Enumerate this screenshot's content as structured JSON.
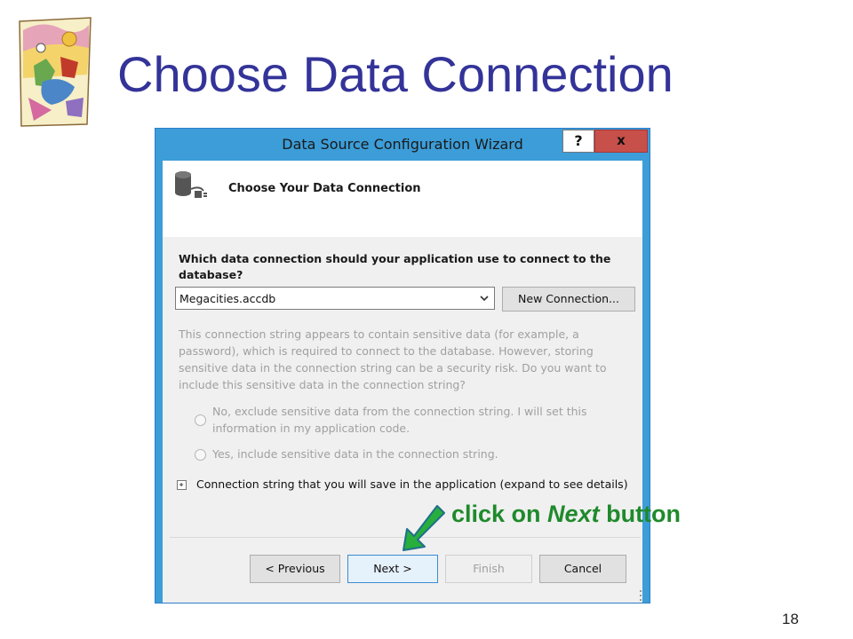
{
  "slide": {
    "title": "Choose Data Connection",
    "number": "18"
  },
  "dialog": {
    "title": "Data Source Configuration Wizard",
    "help_label": "?",
    "close_label": "x",
    "header_title": "Choose Your Data Connection",
    "question": "Which data connection should your application use to connect to the database?",
    "connection_select": {
      "value": "Megacities.accdb"
    },
    "new_connection_label": "New Connection...",
    "info_text": "This connection string appears to contain sensitive data (for example, a password), which is required to connect to the database. However, storing sensitive data in the connection string can be a security risk. Do you want to include this sensitive data in the connection string?",
    "options": [
      {
        "label": "No, exclude sensitive data from the connection string. I will set this information in my application code."
      },
      {
        "label": "Yes, include sensitive data in the connection string."
      }
    ],
    "expander_label": "Connection string that you will save in the application (expand to see details)",
    "buttons": {
      "previous": "< Previous",
      "next": "Next >",
      "finish": "Finish",
      "cancel": "Cancel"
    }
  },
  "annotation": {
    "before": "click on ",
    "emphasis": "Next",
    "after": " button",
    "color": "#1f8a2b"
  },
  "colors": {
    "title": "#333399",
    "titlebar": "#3c9dd8",
    "close": "#c7504a"
  },
  "icons": [
    "clipart-illustration",
    "database-connection-icon",
    "dropdown-arrow-icon",
    "plus-expander-icon",
    "green-arrow-icon"
  ]
}
